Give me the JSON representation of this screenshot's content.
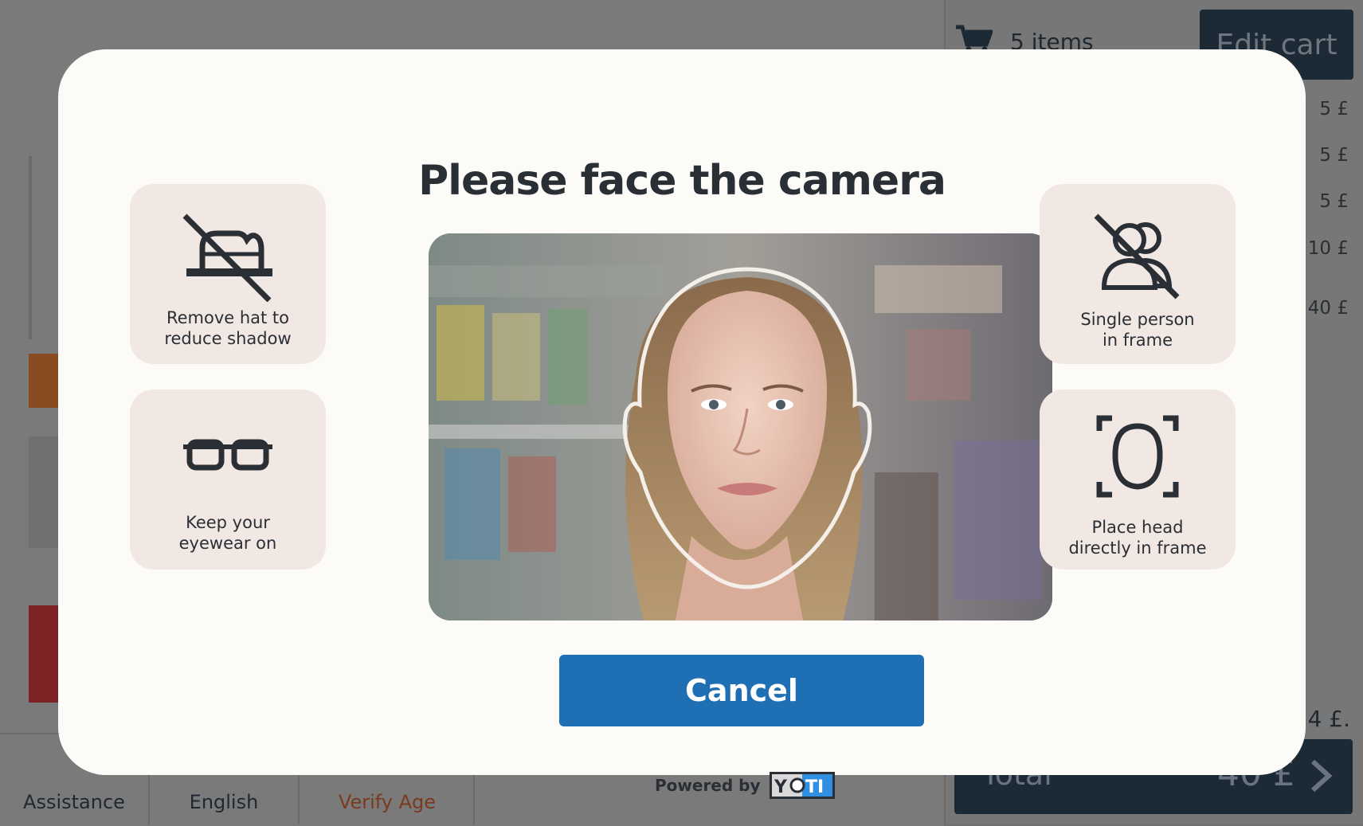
{
  "background": {
    "cart_count": "5 items",
    "edit_cart_label": "Edit cart",
    "prices": [
      "5 £",
      "5 £",
      "5 £",
      "10 £",
      "40 £"
    ],
    "unit_price": "4 £.",
    "total_label": "Total",
    "total_value": "40 £",
    "nav": {
      "assistance": "Assistance",
      "language": "English",
      "verify_age": "Verify Age"
    }
  },
  "modal": {
    "title": "Please face the camera",
    "tips": {
      "hat": [
        "Remove hat to",
        "reduce shadow"
      ],
      "eyewear": [
        "Keep your",
        "eyewear on"
      ],
      "single_person": [
        "Single person",
        "in frame"
      ],
      "place_head": [
        "Place head",
        "directly in frame"
      ]
    },
    "cancel_label": "Cancel",
    "powered_by": "Powered by",
    "brand": "YOTI"
  },
  "colors": {
    "modal_bg": "#fdfbf8",
    "card_bg": "#f2e8e3",
    "primary_button": "#1f6fb5",
    "title_text": "#2a2f36",
    "edit_cart_bg": "#1c2a36"
  }
}
